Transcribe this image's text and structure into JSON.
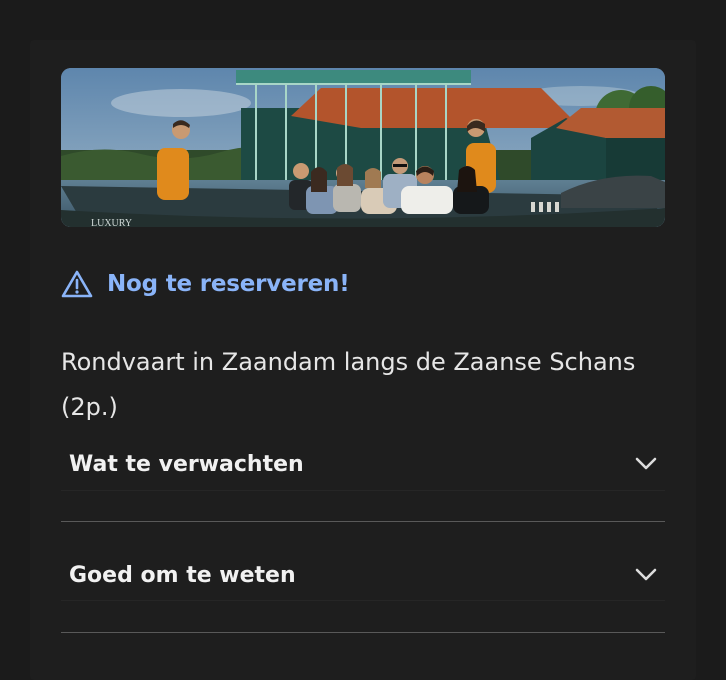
{
  "hero": {
    "image_name": "boat-tour-photo",
    "boat_lettering": "LUXURY"
  },
  "notice": {
    "text": "Nog te reserveren!",
    "icon": "warning-triangle-icon",
    "color": "#8ab4f8"
  },
  "product": {
    "title": "Rondvaart in Zaandam langs de Zaanse Schans (2p.)"
  },
  "accordion": [
    {
      "label": "Wat te verwachten",
      "icon": "chevron-down-icon"
    },
    {
      "label": "Goed om te weten",
      "icon": "chevron-down-icon"
    }
  ],
  "colors": {
    "background": "#1b1b1b",
    "accent": "#8ab4f8",
    "divider": "#595959"
  }
}
